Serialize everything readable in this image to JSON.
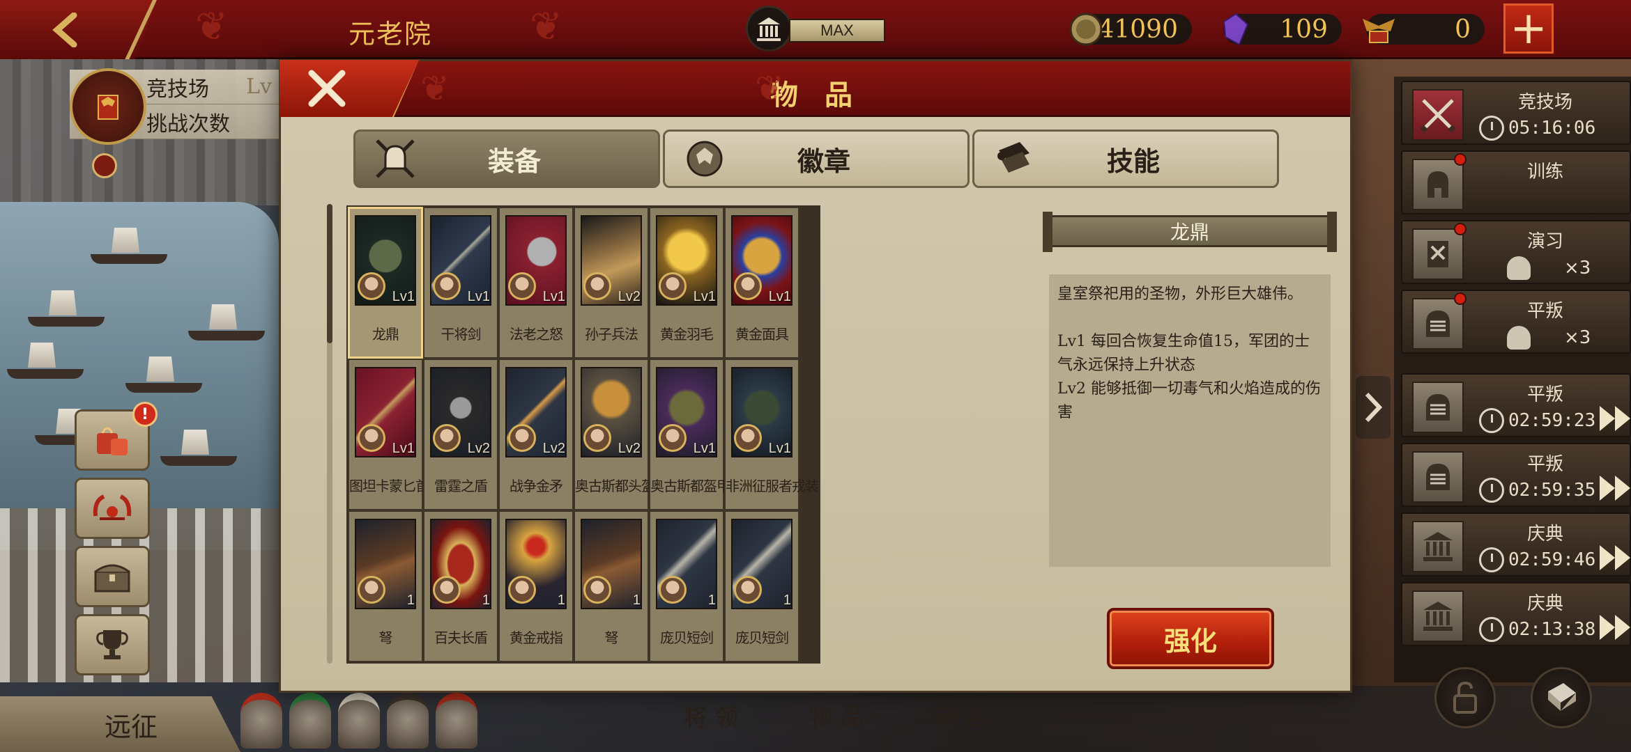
{
  "top_bar": {
    "page_title": "元老院",
    "level_status": "MAX",
    "coins": "41090",
    "gems": "109",
    "spqr_tokens": "0",
    "plus_label": "+"
  },
  "left_panel": {
    "arena_label": "竞技场",
    "arena_level": "Lv",
    "challenge_label": "挑战次数",
    "expedition_label": "远征",
    "alert_mark": "!"
  },
  "bottom_tabs": [
    "将 领",
    "物 品",
    "商 店"
  ],
  "modal": {
    "title": "物 品",
    "tabs": [
      {
        "label": "装备",
        "active": true
      },
      {
        "label": "徽章",
        "active": false
      },
      {
        "label": "技能",
        "active": false
      }
    ],
    "items": [
      {
        "name": "龙鼎",
        "lv": "Lv1"
      },
      {
        "name": "干将剑",
        "lv": "Lv1"
      },
      {
        "name": "法老之怒",
        "lv": "Lv1"
      },
      {
        "name": "孙子兵法",
        "lv": "Lv2"
      },
      {
        "name": "黄金羽毛",
        "lv": "Lv1"
      },
      {
        "name": "黄金面具",
        "lv": "Lv1"
      },
      {
        "name": "图坦卡蒙匕首",
        "lv": "Lv1"
      },
      {
        "name": "雷霆之盾",
        "lv": "Lv2"
      },
      {
        "name": "战争金矛",
        "lv": "Lv2"
      },
      {
        "name": "奥古斯都头盔",
        "lv": "Lv2"
      },
      {
        "name": "奥古斯都盔甲",
        "lv": "Lv1"
      },
      {
        "name": "非洲征服者戎装",
        "lv": "Lv1"
      },
      {
        "name": "弩",
        "lv": "1"
      },
      {
        "name": "百夫长盾",
        "lv": "1"
      },
      {
        "name": "黄金戒指",
        "lv": "1"
      },
      {
        "name": "弩",
        "lv": "1"
      },
      {
        "name": "庞贝短剑",
        "lv": "1"
      },
      {
        "name": "庞贝短剑",
        "lv": "1"
      }
    ],
    "detail": {
      "title": "龙鼎",
      "description": "皇室祭祀用的圣物，外形巨大雄伟。",
      "lv1": "Lv1  每回合恢复生命值15，军团的士气永远保持上升状态",
      "lv2": "Lv2  能够抵御一切毒气和火焰造成的伤害"
    },
    "enhance_label": "强化"
  },
  "right_panel": {
    "items": [
      {
        "name": "竞技场",
        "time": "05:16:06"
      },
      {
        "name": "训练",
        "time": ""
      },
      {
        "name": "演习",
        "count": "×3"
      },
      {
        "name": "平叛",
        "count": "×3"
      },
      {
        "name": "平叛",
        "time": "02:59:23"
      },
      {
        "name": "平叛",
        "time": "02:59:35"
      },
      {
        "name": "庆典",
        "time": "02:59:46"
      },
      {
        "name": "庆典",
        "time": "02:13:38"
      }
    ]
  },
  "colors": {
    "header_red": "#7a1010",
    "gold_text": "#f0c35a",
    "parchment": "#d3c8ad",
    "enhance_red": "#c22a10"
  }
}
